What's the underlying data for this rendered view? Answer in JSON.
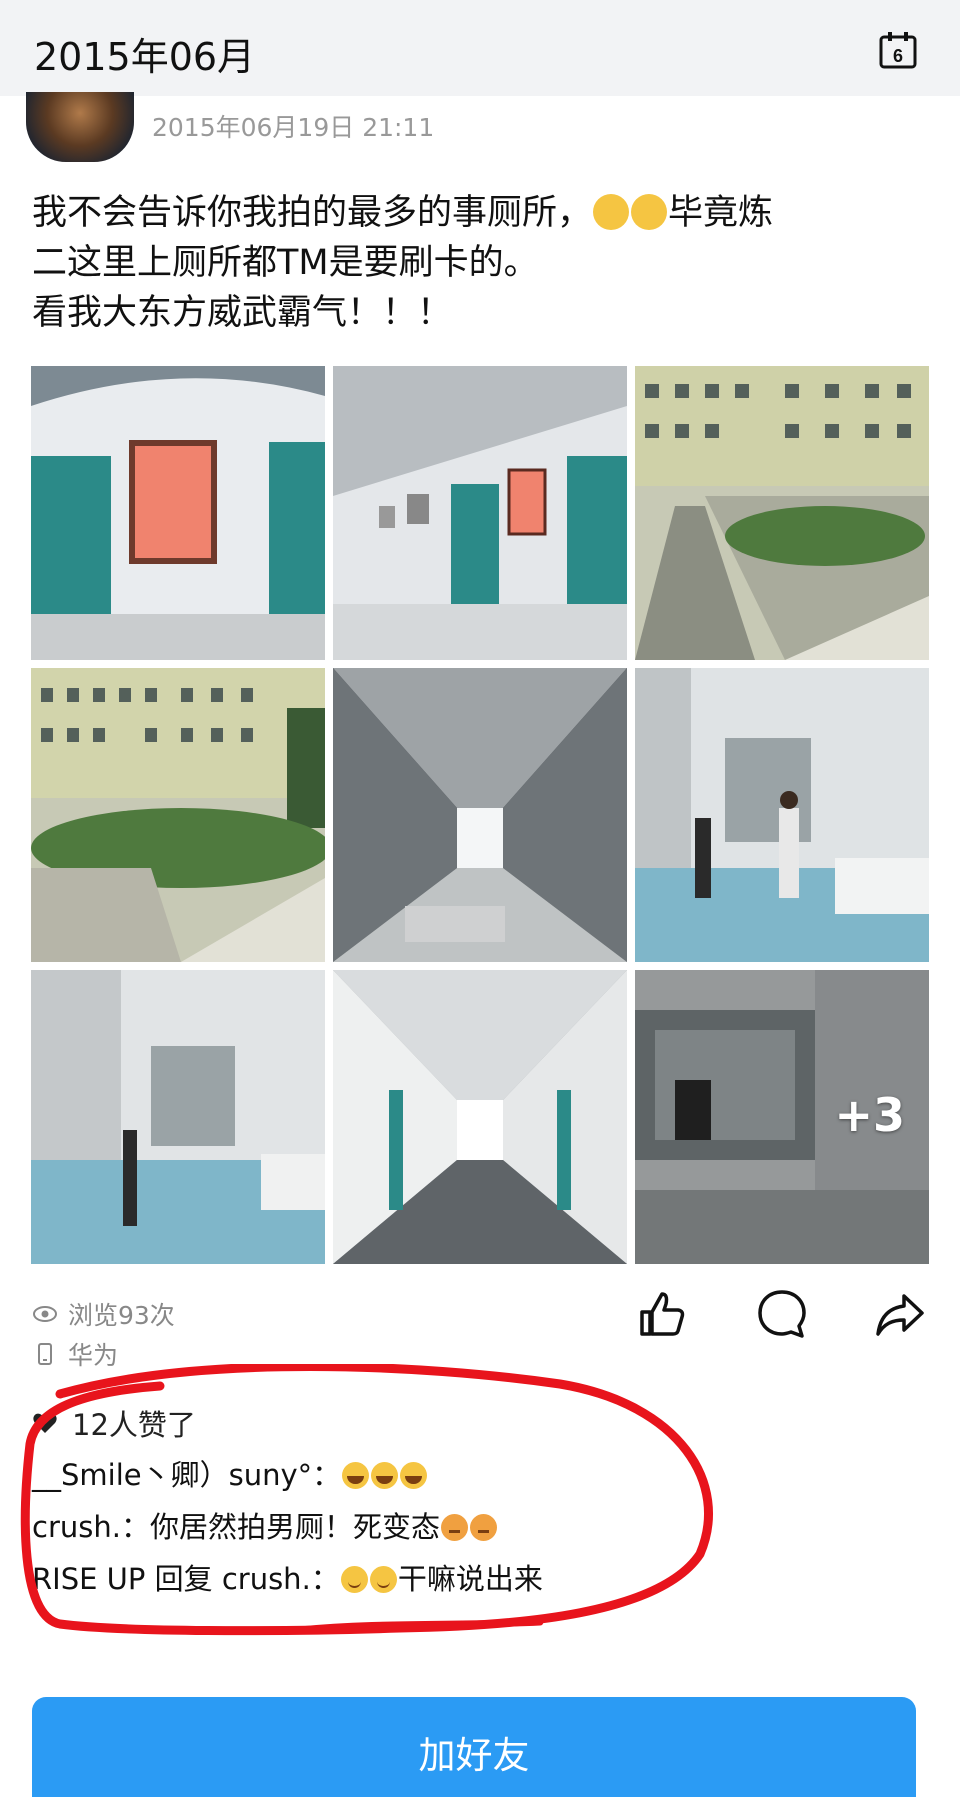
{
  "header": {
    "month": "2015年06月",
    "calendar_day": "6"
  },
  "post": {
    "timestamp": "2015年06月19日 21:11",
    "text_line1_a": "我不会告诉你我拍的最多的事厕所，",
    "text_line1_b": "毕竟炼",
    "text_line2": "二这里上厕所都TM是要刷卡的。",
    "text_line3": "看我大东方威武霸气！！！",
    "more_photos_label": "+3"
  },
  "stats": {
    "views": "浏览93次",
    "device": "华为"
  },
  "likes": {
    "count_label": "12人赞了"
  },
  "comments": [
    {
      "author": "__Smile丶卿）suny°",
      "sep": "：",
      "text": "",
      "emojis": [
        "laugh",
        "laugh",
        "laugh"
      ]
    },
    {
      "author": "crush.",
      "sep": "：",
      "text": "你居然拍男厕！死变态",
      "emojis": [
        "angry",
        "angry"
      ]
    },
    {
      "author": "RISE UP",
      "reply_word": "回复",
      "reply_to": "crush.",
      "sep": "：",
      "text_after_emoji": "干嘛说出来",
      "emojis": [
        "shy",
        "shy"
      ]
    }
  ],
  "footer": {
    "add_friend_label": "加好友"
  },
  "colors": {
    "accent": "#2b9bf4",
    "annotation": "#e8141c"
  }
}
